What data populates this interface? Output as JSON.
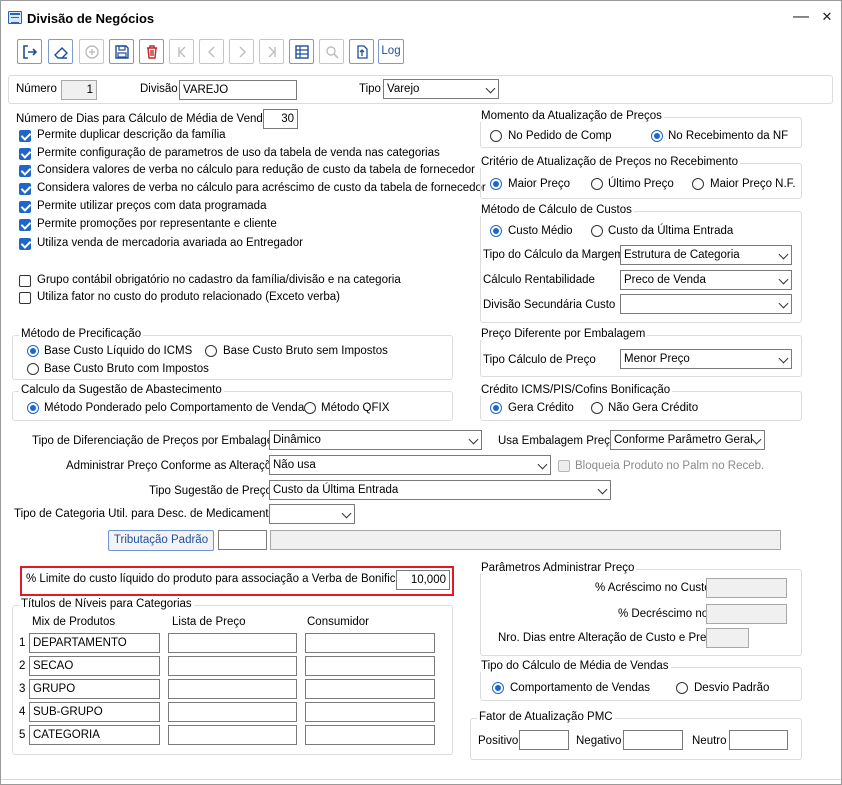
{
  "window": {
    "title": "Divisão de Negócios",
    "minimize": "—",
    "close": "✕"
  },
  "toolbar": {
    "log_label": "Log"
  },
  "header": {
    "numero_label": "Número",
    "numero_value": "1",
    "divisao_label": "Divisão",
    "divisao_value": "VAREJO",
    "tipo_label": "Tipo",
    "tipo_value": "Varejo"
  },
  "left": {
    "num_dias_label": "Número de Dias para Cálculo de Média de Vendas",
    "num_dias_value": "30",
    "checks": [
      {
        "label": "Permite duplicar descrição da família",
        "checked": true
      },
      {
        "label": "Permite configuração de parametros de uso da tabela de venda nas categorias",
        "checked": true
      },
      {
        "label": "Considera valores de verba no cálculo para redução de custo da tabela de fornecedor",
        "checked": true
      },
      {
        "label": "Considera valores de verba no cálculo para acréscimo de custo da tabela de fornecedor",
        "checked": true
      },
      {
        "label": "Permite utilizar preços com data programada",
        "checked": true
      },
      {
        "label": "Permite promoções por representante e cliente",
        "checked": true
      },
      {
        "label": "Utiliza venda de mercadoria avariada ao Entregador",
        "checked": true
      },
      {
        "label": "Grupo contábil obrigatório no cadastro da família/divisão e na categoria",
        "checked": false
      },
      {
        "label": "Utiliza fator no custo do produto relacionado (Exceto verba)",
        "checked": false
      }
    ]
  },
  "metodo_precificacao": {
    "title": "Método de Precificação",
    "options": [
      "Base Custo Líquido do ICMS",
      "Base Custo Bruto sem Impostos",
      "Base Custo Bruto com Impostos"
    ]
  },
  "calculo_sugestao": {
    "title": "Calculo da Sugestão de Abastecimento",
    "options": [
      "Método Ponderado pelo Comportamento de Vendas",
      "Método QFIX"
    ]
  },
  "form": {
    "tipo_dif_label": "Tipo de Diferenciação de Preços por Embalagem",
    "tipo_dif_value": "Dinâmico",
    "usa_emb_label": "Usa Embalagem Preço",
    "usa_emb_value": "Conforme Parâmetro Geral",
    "admin_label": "Administrar Preço Conforme as Alterações",
    "admin_value": "Não usa",
    "bloqueia_label": "Bloqueia Produto no Palm no Receb.",
    "sugestao_label": "Tipo Sugestão de Preço",
    "sugestao_value": "Custo da Última Entrada",
    "categoria_label": "Tipo de Categoria Util. para Desc. de  Medicamentos",
    "categoria_value": "",
    "tributacao_button": "Tributação Padrão"
  },
  "limite": {
    "label": "% Limite do custo líquido do produto para associação a Verba de Bonificação",
    "value": "10,000"
  },
  "titulos": {
    "title": "Títulos de Níveis para Categorias",
    "col_mix": "Mix de Produtos",
    "col_lista": "Lista de Preço",
    "col_consumidor": "Consumidor",
    "rows": [
      {
        "n": "1",
        "mix": "DEPARTAMENTO"
      },
      {
        "n": "2",
        "mix": "SECAO"
      },
      {
        "n": "3",
        "mix": "GRUPO"
      },
      {
        "n": "4",
        "mix": "SUB-GRUPO"
      },
      {
        "n": "5",
        "mix": "CATEGORIA"
      }
    ]
  },
  "momento": {
    "title": "Momento da Atualização de Preços",
    "options": [
      "No Pedido de Compra",
      "No Recebimento da NF"
    ]
  },
  "criterio": {
    "title": "Critério de Atualização de Preços no Recebimento",
    "options": [
      "Maior Preço",
      "Último Preço",
      "Maior Preço N.F."
    ]
  },
  "metodo_custos": {
    "title": "Método de Cálculo de Custos",
    "options": [
      "Custo Médio",
      "Custo da Última Entrada"
    ],
    "margem_label": "Tipo do Cálculo da Margem",
    "margem_value": "Estrutura de Categoria",
    "rentab_label": "Cálculo Rentabilidade",
    "rentab_value": "Preco de Venda",
    "divsec_label": "Divisão Secundária Custo",
    "divsec_value": ""
  },
  "preco_dif": {
    "title": "Preço Diferente por Embalagem",
    "tipo_label": "Tipo Cálculo de Preço",
    "tipo_value": "Menor Preço"
  },
  "credito": {
    "title": "Crédito ICMS/PIS/Cofins Bonificação",
    "options": [
      "Gera Crédito",
      "Não Gera Crédito"
    ]
  },
  "parametros": {
    "title": "Parâmetros Administrar Preço",
    "acresc_label": "% Acréscimo no Custo",
    "decresc_label": "% Decréscimo no",
    "dias_label": "Nro. Dias entre Alteração de Custo e Preço"
  },
  "media_vendas": {
    "title": "Tipo do Cálculo de Média de Vendas",
    "options": [
      "Comportamento de Vendas",
      "Desvio Padrão"
    ]
  },
  "fator": {
    "title": "Fator de Atualização PMC",
    "positivo_label": "Positivo",
    "negativo_label": "Negativo",
    "neutro_label": "Neutro"
  }
}
